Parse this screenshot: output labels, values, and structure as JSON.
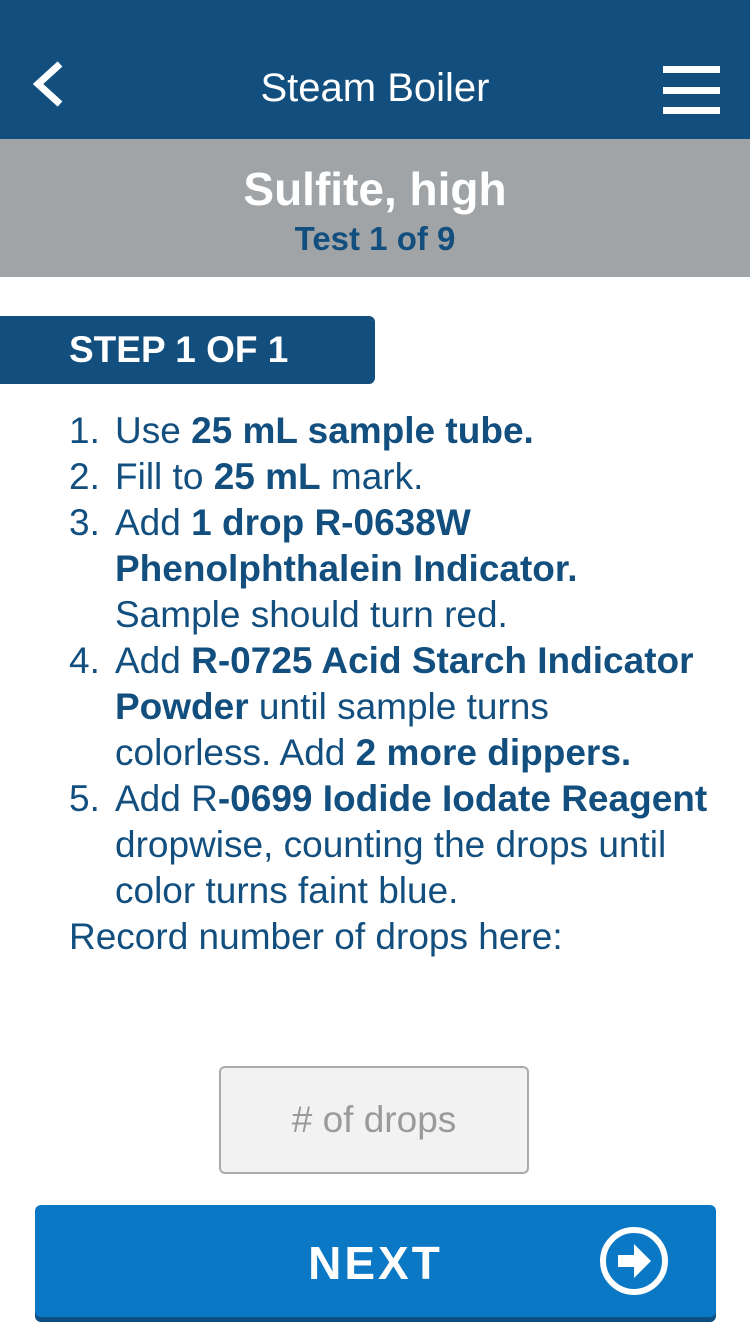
{
  "navbar": {
    "title": "Steam Boiler",
    "back_icon": "chevron-left-icon",
    "menu_icon": "hamburger-menu-icon"
  },
  "test": {
    "name": "Sulfite, high",
    "count": "Test 1 of 9"
  },
  "step": {
    "label": "STEP 1 OF 1"
  },
  "instructions": [
    {
      "num": "1.",
      "parts": [
        {
          "text": "Use ",
          "bold": false
        },
        {
          "text": "25 mL sample tube.",
          "bold": true
        }
      ]
    },
    {
      "num": "2.",
      "parts": [
        {
          "text": "Fill to ",
          "bold": false
        },
        {
          "text": "25 mL",
          "bold": true
        },
        {
          "text": " mark.",
          "bold": false
        }
      ]
    },
    {
      "num": "3.",
      "parts": [
        {
          "text": "Add ",
          "bold": false
        },
        {
          "text": "1 drop R-0638W Phenolphthalein Indicator.",
          "bold": true
        },
        {
          "text": " Sample should turn red.",
          "bold": false
        }
      ]
    },
    {
      "num": "4.",
      "parts": [
        {
          "text": "Add ",
          "bold": false
        },
        {
          "text": "R-0725 Acid Starch Indicator Powder",
          "bold": true
        },
        {
          "text": " until sample turns colorless. Add ",
          "bold": false
        },
        {
          "text": "2 more dippers.",
          "bold": true
        }
      ]
    },
    {
      "num": "5.",
      "parts": [
        {
          "text": "Add R",
          "bold": false
        },
        {
          "text": "-0699 Iodide Iodate Reagent",
          "bold": true
        },
        {
          "text": " dropwise, counting the drops until color turns faint blue.",
          "bold": false
        }
      ]
    }
  ],
  "record_label": "Record number of drops here:",
  "drops_input": {
    "placeholder": "# of drops",
    "value": ""
  },
  "next_button": {
    "label": "NEXT",
    "icon": "arrow-right-circle-icon"
  },
  "colors": {
    "primary_navy": "#124f7f",
    "header_grey": "#a0a4a6",
    "button_blue": "#0b78c6"
  }
}
